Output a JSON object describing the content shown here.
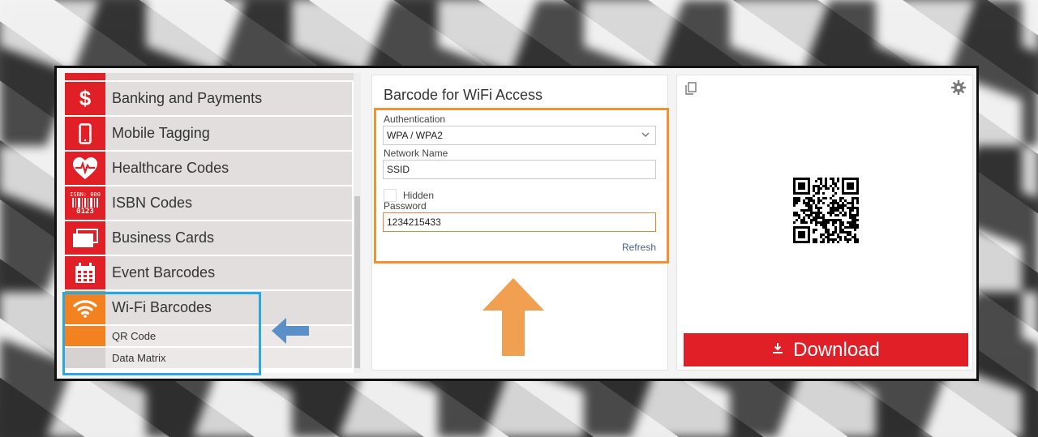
{
  "sidebar": {
    "items": [
      {
        "label": "Banking and Payments",
        "icon": "dollar-icon"
      },
      {
        "label": "Mobile Tagging",
        "icon": "mobile-phone-icon"
      },
      {
        "label": "Healthcare Codes",
        "icon": "heart-pulse-icon"
      },
      {
        "label": "ISBN Codes",
        "icon": "isbn-barcode-icon",
        "icon_text_top": "ISBN: 000",
        "icon_text_bottom": "0123"
      },
      {
        "label": "Business Cards",
        "icon": "business-cards-icon"
      },
      {
        "label": "Event Barcodes",
        "icon": "calendar-icon"
      },
      {
        "label": "Wi-Fi Barcodes",
        "icon": "wifi-icon",
        "active": true
      }
    ],
    "sub_items": [
      {
        "label": "QR Code",
        "active": true
      },
      {
        "label": "Data Matrix",
        "active": false
      }
    ]
  },
  "form": {
    "title": "Barcode for WiFi Access",
    "authentication_label": "Authentication",
    "authentication_value": "WPA / WPA2",
    "network_name_label": "Network Name",
    "network_name_value": "SSID",
    "hidden_label": "Hidden",
    "hidden_checked": false,
    "password_label": "Password",
    "password_value": "1234215433",
    "refresh_label": "Refresh"
  },
  "preview": {
    "download_label": "Download"
  },
  "colors": {
    "brand_red": "#e01f26",
    "active_orange": "#f4811f",
    "highlight_blue": "#29a8e0",
    "highlight_orange": "#f4922f",
    "arrow_orange": "#f0a050",
    "arrow_blue": "#5b8fc7"
  }
}
